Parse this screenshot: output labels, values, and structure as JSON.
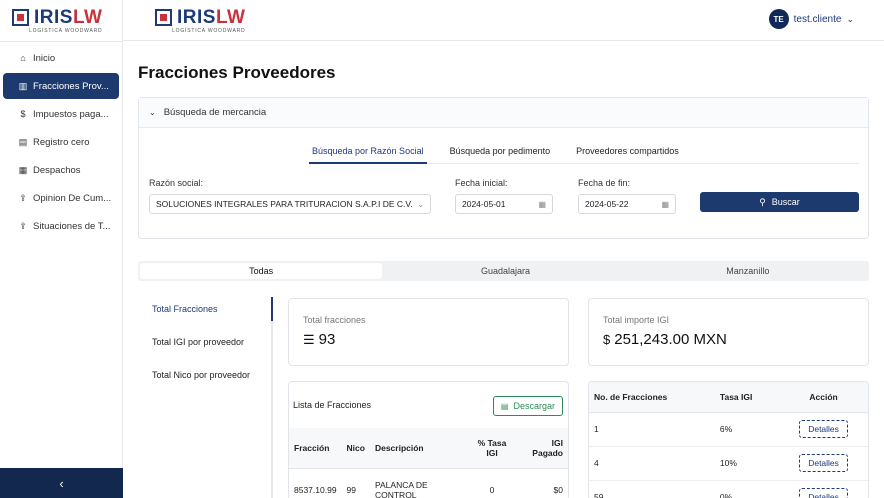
{
  "brand": {
    "name_blue": "IRIS",
    "name_red": "LW",
    "tagline": "LOGÍSTICA WOODWARD"
  },
  "sidebar": {
    "items": [
      {
        "label": "Inicio",
        "icon": "home-icon"
      },
      {
        "label": "Fracciones Prov...",
        "icon": "chart-icon",
        "active": true
      },
      {
        "label": "Impuestos paga...",
        "icon": "dollar-icon"
      },
      {
        "label": "Registro cero",
        "icon": "file-icon"
      },
      {
        "label": "Despachos",
        "icon": "calendar-icon"
      },
      {
        "label": "Opinion De Cum...",
        "icon": "upload-icon"
      },
      {
        "label": "Situaciones de T...",
        "icon": "upload-icon"
      }
    ],
    "collapse_label": "‹"
  },
  "user": {
    "initials": "TE",
    "name": "test.cliente"
  },
  "page": {
    "title": "Fracciones Proveedores"
  },
  "search": {
    "accordion_title": "Búsqueda de mercancia",
    "tabs": [
      "Búsqueda por Razón Social",
      "Búsqueda por pedimento",
      "Proveedores compartidos"
    ],
    "razon_label": "Razón social:",
    "razon_value": "SOLUCIONES INTEGRALES PARA TRITURACION S.A.P.I DE C.V.",
    "fecha_inicial_label": "Fecha inicial:",
    "fecha_inicial_value": "2024-05-01",
    "fecha_fin_label": "Fecha de fin:",
    "fecha_fin_value": "2024-05-22",
    "buscar_label": "Buscar"
  },
  "locations": [
    "Todas",
    "Guadalajara",
    "Manzanillo"
  ],
  "vtabs": [
    "Total Fracciones",
    "Total IGI por proveedor",
    "Total Nico por proveedor"
  ],
  "stats": {
    "fracciones_label": "Total fracciones",
    "fracciones_value": "93",
    "igi_label": "Total importe IGI",
    "igi_value": "251,243.00 MXN"
  },
  "list": {
    "title": "Lista de Fracciones",
    "download_label": "Descargar",
    "headers": [
      "Fracción",
      "Nico",
      "Descripción",
      "% Tasa IGI",
      "IGI Pagado"
    ],
    "rows": [
      [
        "8537.10.99",
        "99",
        "PALANCA DE CONTROL",
        "0",
        "$0"
      ]
    ]
  },
  "per_table": {
    "headers": [
      "No. de Fracciones",
      "Tasa IGI",
      "Acción"
    ],
    "rows": [
      [
        "1",
        "6%",
        "Detalles"
      ],
      [
        "4",
        "10%",
        "Detalles"
      ],
      [
        "59",
        "0%",
        "Detalles"
      ]
    ]
  },
  "colors": {
    "primary": "#1d3a6e",
    "brand_red": "#c8323c",
    "success": "#2e8b57"
  }
}
